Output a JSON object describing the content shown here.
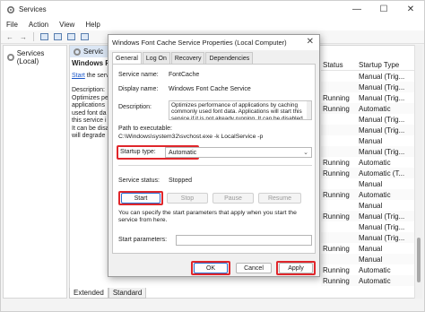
{
  "window": {
    "title": "Services",
    "controls": {
      "minimize": "—",
      "maximize": "☐",
      "close": "✕"
    }
  },
  "menu": [
    "File",
    "Action",
    "View",
    "Help"
  ],
  "tree": {
    "root_label": "Services (Local)"
  },
  "content": {
    "tab_label": "Servic",
    "detail": {
      "title": "Windows Font",
      "start_link": "Start",
      "start_suffix": " the servi",
      "desc_label": "Description:",
      "desc_lines": [
        "Optimizes pe",
        "applications",
        "used font da",
        "this service i",
        "It can be disa",
        "will degrade"
      ]
    },
    "list": {
      "headers": {
        "status": "Status",
        "startup_type": "Startup Type"
      },
      "rows": [
        {
          "status": "",
          "type": "Manual (Trig..."
        },
        {
          "status": "",
          "type": "Manual (Trig..."
        },
        {
          "status": "Running",
          "type": "Manual (Trig..."
        },
        {
          "status": "Running",
          "type": "Automatic"
        },
        {
          "status": "",
          "type": "Manual (Trig..."
        },
        {
          "status": "",
          "type": "Manual (Trig..."
        },
        {
          "status": "",
          "type": "Manual"
        },
        {
          "status": "",
          "type": "Manual (Trig..."
        },
        {
          "status": "Running",
          "type": "Automatic"
        },
        {
          "status": "Running",
          "type": "Automatic (T..."
        },
        {
          "status": "",
          "type": "Manual"
        },
        {
          "status": "Running",
          "type": "Automatic"
        },
        {
          "status": "",
          "type": "Manual"
        },
        {
          "status": "Running",
          "type": "Manual (Trig..."
        },
        {
          "status": "",
          "type": "Manual (Trig..."
        },
        {
          "status": "",
          "type": "Manual (Trig..."
        },
        {
          "status": "Running",
          "type": "Manual"
        },
        {
          "status": "",
          "type": "Manual"
        },
        {
          "status": "Running",
          "type": "Automatic"
        },
        {
          "status": "Running",
          "type": "Automatic"
        }
      ]
    },
    "bottom_tabs": [
      "Extended",
      "Standard"
    ]
  },
  "dialog": {
    "title": "Windows Font Cache Service Properties (Local Computer)",
    "tabs": [
      "General",
      "Log On",
      "Recovery",
      "Dependencies"
    ],
    "service_name_label": "Service name:",
    "service_name": "FontCache",
    "display_name_label": "Display name:",
    "display_name": "Windows Font Cache Service",
    "description_label": "Description:",
    "description": "Optimizes performance of applications by caching commonly used font data. Applications will start this service if it is not already running. It can be disabled",
    "path_label": "Path to executable:",
    "path": "C:\\Windows\\system32\\svchost.exe -k LocalService -p",
    "startup_type_label": "Startup type:",
    "startup_type": "Automatic",
    "status_label": "Service status:",
    "status": "Stopped",
    "buttons": {
      "start": "Start",
      "stop": "Stop",
      "pause": "Pause",
      "resume": "Resume"
    },
    "hint": "You can specify the start parameters that apply when you start the service from here.",
    "params_label": "Start parameters:",
    "footer": {
      "ok": "OK",
      "cancel": "Cancel",
      "apply": "Apply"
    }
  },
  "colors": {
    "highlight": "#e0262b",
    "link": "#1a56c8",
    "selected_tab": "#dbe6f4"
  }
}
